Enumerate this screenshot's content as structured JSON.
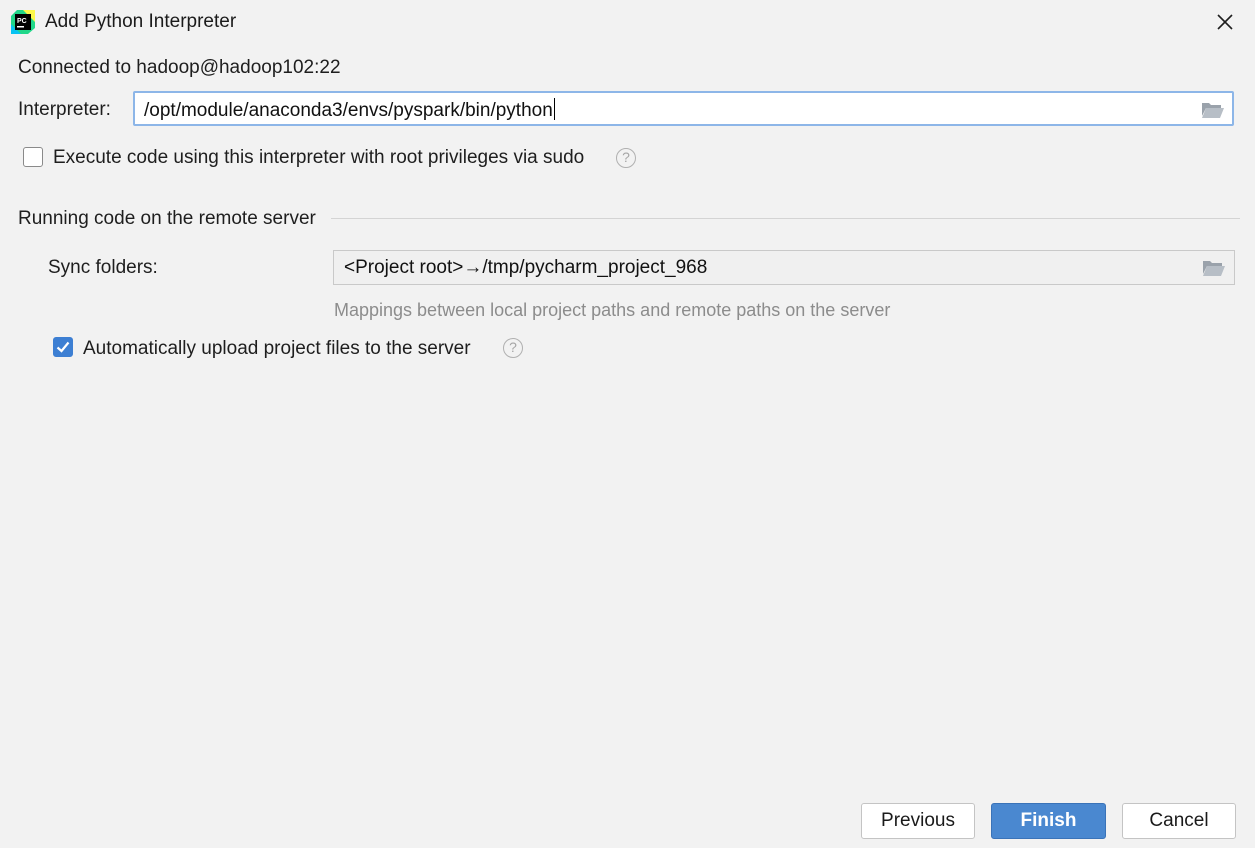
{
  "window": {
    "title": "Add Python Interpreter",
    "app_icon_text": "PC"
  },
  "connection": {
    "text": "Connected to hadoop@hadoop102:22"
  },
  "interpreter": {
    "label": "Interpreter:",
    "value": "/opt/module/anaconda3/envs/pyspark/bin/python"
  },
  "sudo_option": {
    "label": "Execute code using this interpreter with root privileges via sudo",
    "checked": false
  },
  "remote_section": {
    "title": "Running code on the remote server",
    "sync_label": "Sync folders:",
    "sync_value": "<Project root>→/tmp/pycharm_project_968",
    "sync_hint": "Mappings between local project paths and remote paths on the server",
    "auto_upload_label": "Automatically upload project files to the server",
    "auto_upload_checked": true
  },
  "buttons": {
    "previous": "Previous",
    "finish": "Finish",
    "cancel": "Cancel"
  },
  "colors": {
    "accent": "#4a88d0",
    "focus_border": "#8db6e8",
    "background": "#f2f2f2"
  },
  "icons": [
    "pycharm-app-icon",
    "close-icon",
    "folder-open-icon",
    "help-icon",
    "checkmark-icon"
  ]
}
